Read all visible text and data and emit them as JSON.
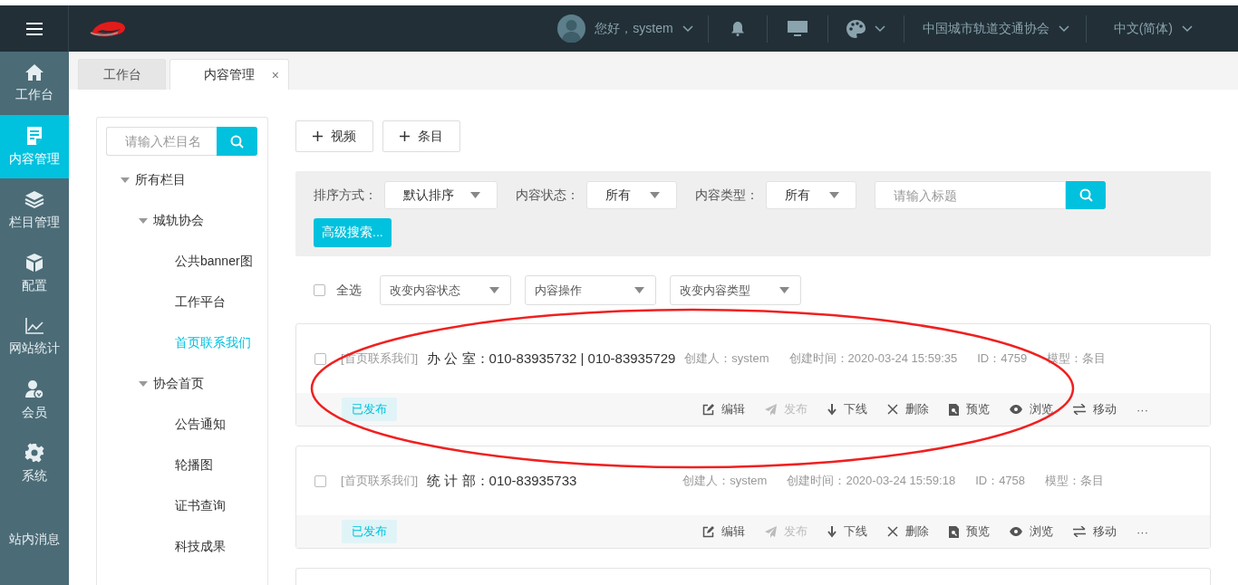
{
  "header": {
    "greeting": "您好，system",
    "organization": "中国城市轨道交通协会",
    "language": "中文(简体)"
  },
  "sidebar": {
    "items": [
      {
        "label": "工作台",
        "kind": "home",
        "selected": false
      },
      {
        "label": "内容管理",
        "kind": "document",
        "selected": true
      },
      {
        "label": "栏目管理",
        "kind": "layers",
        "selected": false
      },
      {
        "label": "配置",
        "kind": "cube",
        "selected": false
      },
      {
        "label": "网站统计",
        "kind": "chart",
        "selected": false
      },
      {
        "label": "会员",
        "kind": "member",
        "selected": false
      },
      {
        "label": "系统",
        "kind": "gear",
        "selected": false
      },
      {
        "label": "站内消息",
        "kind": "plain",
        "selected": false
      }
    ]
  },
  "tabs": [
    {
      "label": "工作台",
      "selected": false
    },
    {
      "label": "内容管理",
      "selected": true,
      "close": "×"
    }
  ],
  "tree": {
    "search_placeholder": "请输入栏目名",
    "nodes": [
      {
        "label": "所有栏目",
        "expanded": true,
        "selected": false,
        "children": [
          {
            "label": "城轨协会",
            "expanded": true,
            "selected": false,
            "children": [
              {
                "label": "公共banner图",
                "selected": false
              },
              {
                "label": "工作平台",
                "selected": false
              },
              {
                "label": "首页联系我们",
                "selected": true
              }
            ]
          },
          {
            "label": "协会首页",
            "expanded": true,
            "selected": false,
            "children": [
              {
                "label": "公告通知",
                "selected": false
              },
              {
                "label": "轮播图",
                "selected": false
              },
              {
                "label": "证书查询",
                "selected": false
              },
              {
                "label": "科技成果",
                "selected": false
              }
            ]
          }
        ]
      }
    ]
  },
  "toolbar": {
    "buttons": [
      "视频",
      "条目"
    ]
  },
  "filters": {
    "fields": [
      {
        "label": "排序方式：",
        "value": "默认排序"
      },
      {
        "label": "内容状态：",
        "value": "所有"
      },
      {
        "label": "内容类型：",
        "value": "所有"
      }
    ],
    "search_placeholder": "请输入标题",
    "advanced_button": "高级搜索..."
  },
  "batch": {
    "select_all": {
      "label": "全选",
      "checked": false
    },
    "dropdowns": [
      "改变内容状态",
      "内容操作",
      "改变内容类型"
    ]
  },
  "items": [
    {
      "checked": false,
      "category": "[首页联系我们]",
      "title": "办 公 室：010-83935732 | 010-83935729",
      "meta": [
        "创建人：system",
        "创建时间：2020-03-24 15:59:35",
        "ID：4759",
        "模型：条目"
      ],
      "status": "已发布",
      "actions": [
        {
          "kind": "edit",
          "label": "编辑",
          "disabled": false
        },
        {
          "kind": "publish",
          "label": "发布",
          "disabled": true
        },
        {
          "kind": "offline",
          "label": "下线",
          "disabled": false
        },
        {
          "kind": "delete",
          "label": "删除",
          "disabled": false
        },
        {
          "kind": "preview",
          "label": "预览",
          "disabled": false
        },
        {
          "kind": "view",
          "label": "浏览",
          "disabled": false
        },
        {
          "kind": "move",
          "label": "移动",
          "disabled": false
        },
        {
          "kind": "more",
          "label": "···",
          "disabled": false
        }
      ]
    },
    {
      "checked": false,
      "category": "[首页联系我们]",
      "title": "统 计 部：010-83935733",
      "meta": [
        "创建人：system",
        "创建时间：2020-03-24 15:59:18",
        "ID：4758",
        "模型：条目"
      ],
      "status": "已发布",
      "actions": [
        {
          "kind": "edit",
          "label": "编辑",
          "disabled": false
        },
        {
          "kind": "publish",
          "label": "发布",
          "disabled": true
        },
        {
          "kind": "offline",
          "label": "下线",
          "disabled": false
        },
        {
          "kind": "delete",
          "label": "删除",
          "disabled": false
        },
        {
          "kind": "preview",
          "label": "预览",
          "disabled": false
        },
        {
          "kind": "view",
          "label": "浏览",
          "disabled": false
        },
        {
          "kind": "move",
          "label": "移动",
          "disabled": false
        },
        {
          "kind": "more",
          "label": "···",
          "disabled": false
        }
      ]
    }
  ],
  "annotation": {
    "kind": "ellipse"
  }
}
